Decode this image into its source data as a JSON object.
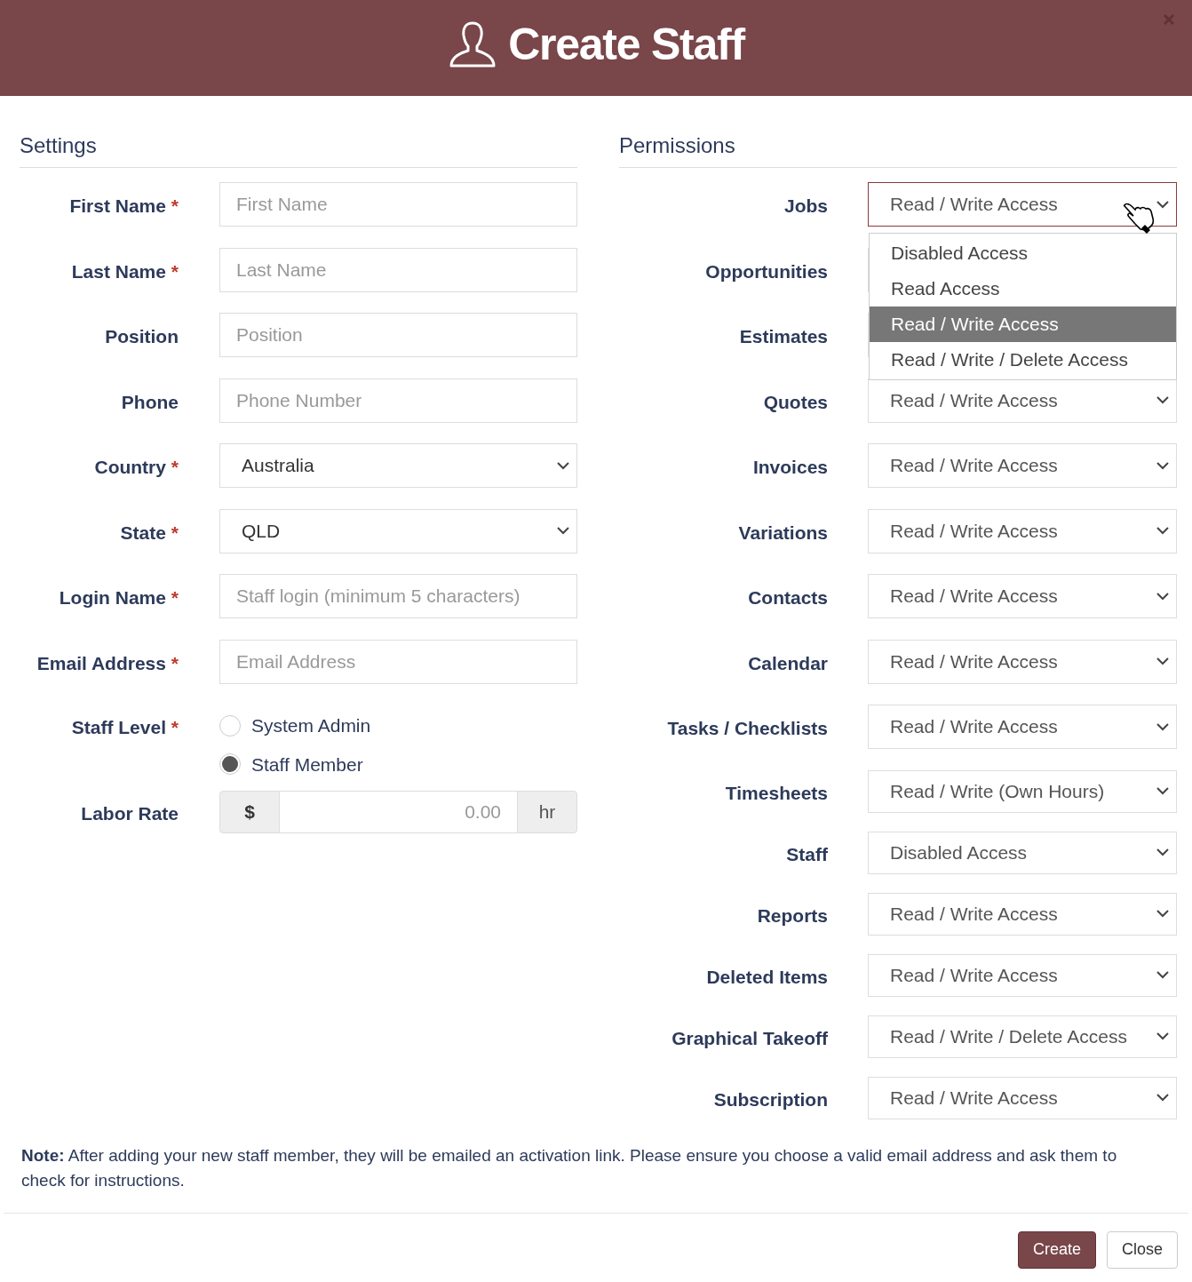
{
  "dialog": {
    "title": "Create Staff"
  },
  "settings": {
    "heading": "Settings",
    "fields": [
      {
        "kind": "text",
        "label": "First Name",
        "required_mark": "*",
        "placeholder": "First Name"
      },
      {
        "kind": "text",
        "label": "Last Name",
        "required_mark": "*",
        "placeholder": "Last Name"
      },
      {
        "kind": "text",
        "label": "Position",
        "placeholder": "Position"
      },
      {
        "kind": "text",
        "label": "Phone",
        "placeholder": "Phone Number"
      },
      {
        "kind": "select",
        "label": "Country",
        "required_mark": "*",
        "value": "Australia"
      },
      {
        "kind": "select",
        "label": "State",
        "required_mark": "*",
        "value": "QLD"
      },
      {
        "kind": "text",
        "label": "Login Name",
        "required_mark": "*",
        "placeholder": "Staff login (minimum 5 characters)"
      },
      {
        "kind": "text",
        "label": "Email Address",
        "required_mark": "*",
        "placeholder": "Email Address"
      },
      {
        "kind": "radio",
        "label": "Staff Level",
        "required_mark": "*",
        "options": [
          {
            "label": "System Admin",
            "selected": false
          },
          {
            "label": "Staff Member",
            "selected": true
          }
        ]
      },
      {
        "kind": "addon",
        "label": "Labor Rate",
        "prefix": "$",
        "placeholder": "0.00",
        "suffix": "hr"
      }
    ]
  },
  "permissions": {
    "heading": "Permissions",
    "items": [
      {
        "label": "Jobs",
        "value": "Read / Write Access",
        "focused": true,
        "options": [
          {
            "label": "Disabled Access",
            "selected": false
          },
          {
            "label": "Read Access",
            "selected": false
          },
          {
            "label": "Read / Write Access",
            "selected": true
          },
          {
            "label": "Read / Write / Delete Access",
            "selected": false
          }
        ]
      },
      {
        "label": "Opportunities",
        "focused": false
      },
      {
        "label": "Estimates",
        "focused": false
      },
      {
        "label": "Quotes",
        "value": "Read / Write Access",
        "focused": false
      },
      {
        "label": "Invoices",
        "value": "Read / Write Access",
        "focused": false
      },
      {
        "label": "Variations",
        "value": "Read / Write Access",
        "focused": false
      },
      {
        "label": "Contacts",
        "value": "Read / Write Access",
        "focused": false
      },
      {
        "label": "Calendar",
        "value": "Read / Write Access",
        "focused": false
      },
      {
        "label": "Tasks / Checklists",
        "value": "Read / Write Access",
        "focused": false
      },
      {
        "label": "Timesheets",
        "value": "Read / Write (Own Hours)",
        "focused": false
      },
      {
        "label": "Staff",
        "value": "Disabled Access",
        "focused": false
      },
      {
        "label": "Reports",
        "value": "Read / Write Access",
        "focused": false
      },
      {
        "label": "Deleted Items",
        "value": "Read / Write Access",
        "focused": false
      },
      {
        "label": "Graphical Takeoff",
        "value": "Read / Write / Delete Access",
        "focused": false
      },
      {
        "label": "Subscription",
        "value": "Read / Write Access",
        "focused": false
      }
    ]
  },
  "note": "**Note:** After adding your new staff member, they will be emailed an activation link. Please ensure you choose a valid email address and ask them to check for instructions.",
  "buttons": [
    {
      "kind": "primary",
      "label": "Create"
    },
    {
      "kind": "default",
      "label": "Close"
    }
  ]
}
